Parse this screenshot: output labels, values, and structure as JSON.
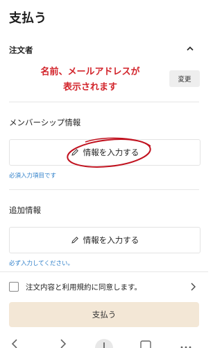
{
  "page": {
    "title": "支払う"
  },
  "orderer": {
    "label": "注文者",
    "annotation_lines": [
      "名前、メールアドレスが",
      "表示されます"
    ],
    "change_label": "変更"
  },
  "membership": {
    "label": "メンバーシップ情報",
    "input_label": "情報を入力する",
    "hint": "必須入力項目です"
  },
  "additional": {
    "label": "追加情報",
    "input_label": "情報を入力する",
    "hint": "必ず入力してください。"
  },
  "agreement": {
    "label": "注文内容と利用規約に同意します。"
  },
  "pay_button": {
    "label": "支払う"
  },
  "colors": {
    "annotation": "#d2232a",
    "hint": "#2e7fc9",
    "pay_button_bg": "#f3e7d6"
  },
  "icons": [
    "chevron-up-icon",
    "pencil-icon",
    "chevron-right-icon",
    "back-icon",
    "forward-icon",
    "plus-icon",
    "tabs-icon",
    "more-icon"
  ]
}
